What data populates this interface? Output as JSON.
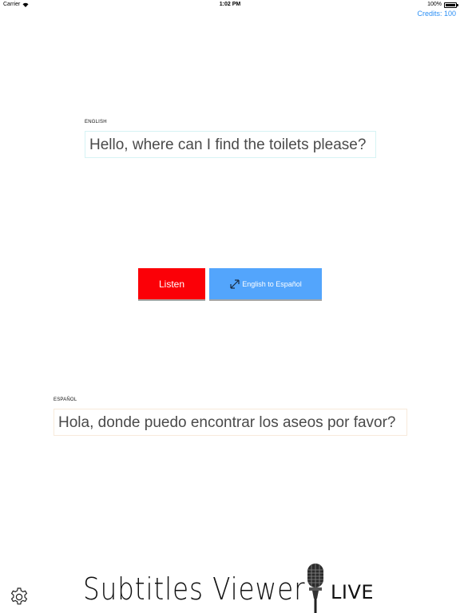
{
  "status_bar": {
    "carrier": "Carrier",
    "time": "1:02 PM",
    "battery": "100%"
  },
  "credits": "Credits: 100",
  "source": {
    "language_label": "ENGLISH",
    "text": "Hello, where can I find the toilets please?"
  },
  "target": {
    "language_label": "ESPAÑOL",
    "text": "Hola, donde puedo encontrar los aseos por favor?"
  },
  "buttons": {
    "listen": "Listen",
    "direction": "English to Español"
  },
  "logo": {
    "title": "Subtitles Viewer",
    "suffix": "LIVE"
  },
  "colors": {
    "accent": "#2b8ff5",
    "listen": "#fb0007",
    "direction": "#53a5fc"
  },
  "icons": {
    "settings": "gear-icon",
    "direction": "swap-arrows-icon",
    "logo": "microphone-icon"
  }
}
